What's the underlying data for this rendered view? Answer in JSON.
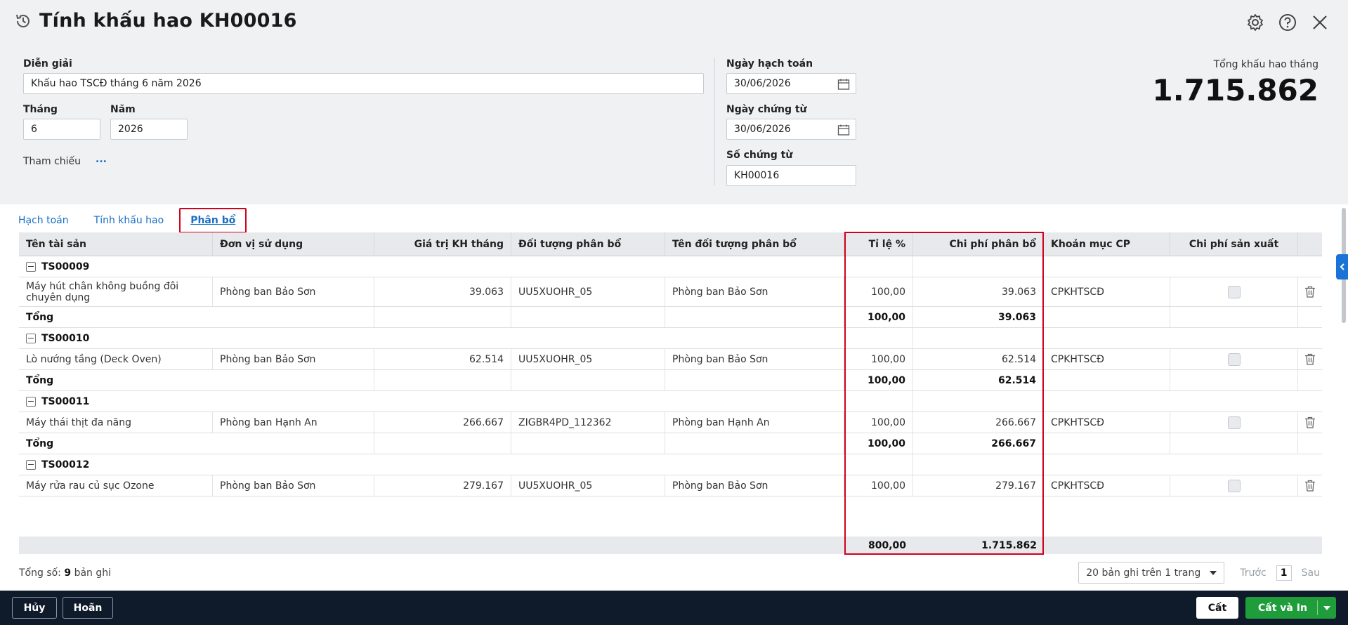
{
  "header": {
    "title": "Tính khấu hao KH00016",
    "dien_giai_label": "Diễn giải",
    "dien_giai_value": "Khấu hao TSCĐ tháng 6 năm 2026",
    "thang_label": "Tháng",
    "thang_value": "6",
    "nam_label": "Năm",
    "nam_value": "2026",
    "tham_chieu_label": "Tham chiếu",
    "tham_chieu_link": "...",
    "ngay_hach_toan_label": "Ngày hạch toán",
    "ngay_hach_toan_value": "30/06/2026",
    "ngay_chung_tu_label": "Ngày chứng từ",
    "ngay_chung_tu_value": "30/06/2026",
    "so_chung_tu_label": "Số chứng từ",
    "so_chung_tu_value": "KH00016",
    "tong_khau_hao_label": "Tổng khấu hao tháng",
    "tong_khau_hao_value": "1.715.862"
  },
  "icons": {
    "history": "history-icon",
    "settings": "gear-icon",
    "help": "help-icon",
    "close": "close-icon",
    "calendar": "calendar-icon",
    "delete": "trash-icon"
  },
  "tabs": [
    {
      "label": "Hạch toán"
    },
    {
      "label": "Tính khấu hao"
    },
    {
      "label": "Phân bổ"
    }
  ],
  "grid": {
    "columns": [
      "Tên tài sản",
      "Đơn vị sử dụng",
      "Giá trị KH tháng",
      "Đối tượng phân bổ",
      "Tên đối tượng phân bổ",
      "Tỉ lệ %",
      "Chi phí phân bổ",
      "Khoản mục CP",
      "Chi phí sản xuất"
    ],
    "groups": [
      {
        "code": "TS00009",
        "item": {
          "ten": "Máy hút chân không buồng đôi chuyên dụng",
          "don_vi": "Phòng ban Bảo Sơn",
          "gia_tri": "39.063",
          "doi_tuong": "UU5XUOHR_05",
          "ten_doi_tuong": "Phòng ban Bảo Sơn",
          "ti_le": "100,00",
          "chi_phi": "39.063",
          "khoan_muc": "CPKHTSCĐ"
        },
        "total_label": "Tổng",
        "total_ti_le": "100,00",
        "total_chi_phi": "39.063"
      },
      {
        "code": "TS00010",
        "item": {
          "ten": "Lò nướng tầng (Deck Oven)",
          "don_vi": "Phòng ban Bảo Sơn",
          "gia_tri": "62.514",
          "doi_tuong": "UU5XUOHR_05",
          "ten_doi_tuong": "Phòng ban Bảo Sơn",
          "ti_le": "100,00",
          "chi_phi": "62.514",
          "khoan_muc": "CPKHTSCĐ"
        },
        "total_label": "Tổng",
        "total_ti_le": "100,00",
        "total_chi_phi": "62.514"
      },
      {
        "code": "TS00011",
        "item": {
          "ten": "Máy thái thịt đa năng",
          "don_vi": "Phòng ban Hạnh An",
          "gia_tri": "266.667",
          "doi_tuong": "ZIGBR4PD_112362",
          "ten_doi_tuong": "Phòng ban Hạnh An",
          "ti_le": "100,00",
          "chi_phi": "266.667",
          "khoan_muc": "CPKHTSCĐ"
        },
        "total_label": "Tổng",
        "total_ti_le": "100,00",
        "total_chi_phi": "266.667"
      },
      {
        "code": "TS00012",
        "item": {
          "ten": "Máy rửa rau củ sục Ozone",
          "don_vi": "Phòng ban Bảo Sơn",
          "gia_tri": "279.167",
          "doi_tuong": "UU5XUOHR_05",
          "ten_doi_tuong": "Phòng ban Bảo Sơn",
          "ti_le": "100,00",
          "chi_phi": "279.167",
          "khoan_muc": "CPKHTSCĐ"
        }
      }
    ],
    "footer_ti_le": "800,00",
    "footer_chi_phi": "1.715.862"
  },
  "pager": {
    "count_prefix": "Tổng số:",
    "count_value": "9",
    "count_suffix": "bản ghi",
    "page_size": "20 bản ghi trên 1 trang",
    "prev": "Trước",
    "page": "1",
    "next": "Sau"
  },
  "buttons": {
    "huy": "Hủy",
    "hoan": "Hoãn",
    "cat": "Cất",
    "cat_va_in": "Cất và In"
  },
  "colors": {
    "accent": "#1a6fc4",
    "highlight": "#d0021b",
    "save_print": "#1f9d3a",
    "bottom_bar": "#0f1a2b"
  }
}
